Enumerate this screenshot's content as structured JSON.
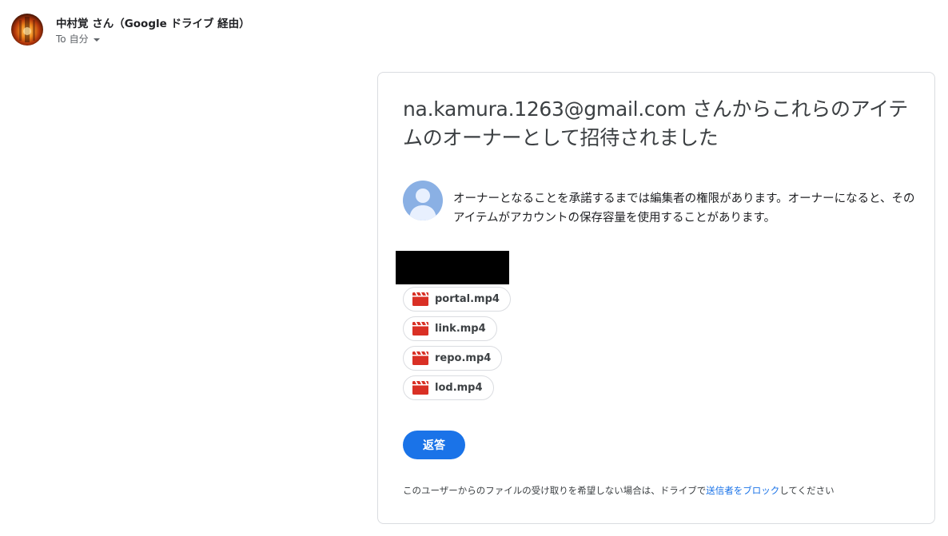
{
  "header": {
    "sender_name": "中村覚 さん（Google ドライブ 経由）",
    "recipient_prefix": "To",
    "recipient": "自分"
  },
  "card": {
    "title": "na.kamura.1263@gmail.com さんからこれらのアイテムのオーナーとして招待されました",
    "notice": "オーナーとなることを承諾するまでは編集者の権限があります。オーナーになると、そのアイテムがアカウントの保存容量を使用することがあります。",
    "files": [
      {
        "name": "portal.mp4",
        "icon": "video-file-icon"
      },
      {
        "name": "link.mp4",
        "icon": "video-file-icon"
      },
      {
        "name": "repo.mp4",
        "icon": "video-file-icon"
      },
      {
        "name": "lod.mp4",
        "icon": "video-file-icon"
      }
    ],
    "reply_label": "返答",
    "footer_prefix": "このユーザーからのファイルの受け取りを希望しない場合は、ドライブで",
    "footer_link": "送信者をブロック",
    "footer_suffix": "してください"
  },
  "colors": {
    "accent": "#1a73e8",
    "video_icon": "#d93025",
    "border": "#dadce0"
  }
}
